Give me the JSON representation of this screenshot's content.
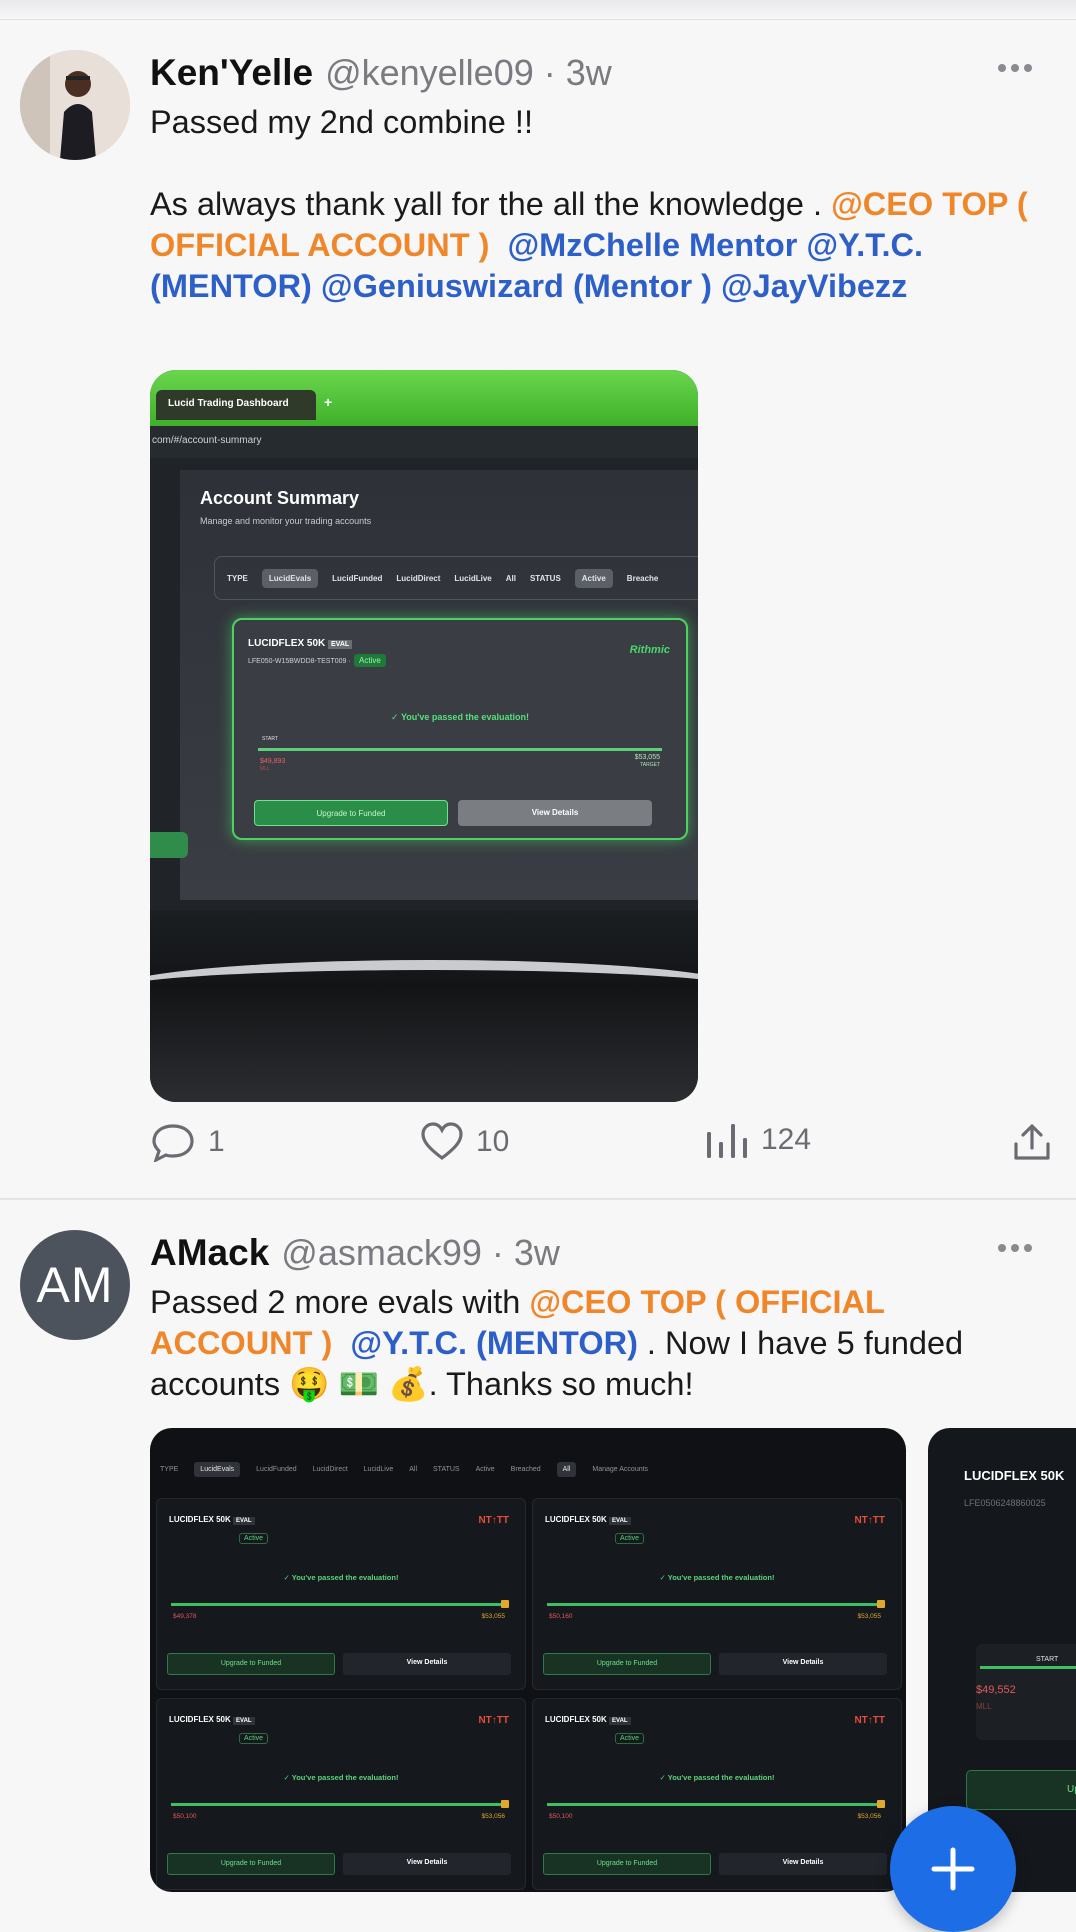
{
  "posts": [
    {
      "name": "Ken'Yelle",
      "handle": "@kenyelle09 · 3w",
      "line1": "Passed my 2nd combine !!",
      "line2_prefix": "As always thank yall for the all the knowledge . ",
      "mention_ceo": "@CEO TOP ( OFFICIAL ACCOUNT )",
      "mention_mzchelle": "@MzChelle Mentor",
      "mention_ytc": "@Y.T.C.  (MENTOR)",
      "mention_genius": "@Geniuswizard (Mentor )",
      "mention_jay": "@JayVibezz",
      "media": {
        "tab_title": "Lucid Trading Dashboard",
        "url": "com/#/account-summary",
        "heading": "Account Summary",
        "subheading": "Manage and monitor your trading accounts",
        "filter_type": "TYPE",
        "filters": [
          "LucidEvals",
          "LucidFunded",
          "LucidDirect",
          "LucidLive",
          "All"
        ],
        "status_label": "STATUS",
        "status_filters": [
          "Active",
          "Breache"
        ],
        "card_title": "LUCIDFLEX 50K",
        "card_tag": "EVAL",
        "card_id": "LFE050-W15BWDD8-TEST009 ·",
        "card_status": "Active",
        "provider": "Rithmic",
        "passed_text": "You've passed the evaluation!",
        "mll_value": "$49,893",
        "mll_label": "MLL",
        "target_value": "$53,055",
        "target_label": "TARGET",
        "start_label": "START",
        "upgrade_button": "Upgrade to Funded",
        "details_button": "View Details"
      },
      "actions": {
        "replies": "1",
        "likes": "10",
        "views": "124"
      }
    },
    {
      "name": "AMack",
      "handle": "@asmack99 · 3w",
      "avatar_initials": "AM",
      "text_prefix": "Passed 2 more evals with ",
      "mention_ceo": "@CEO TOP ( OFFICIAL ACCOUNT )",
      "mention_ytc": "@Y.T.C.  (MENTOR)",
      "text_mid": " .  Now I have 5 funded accounts 🤑 💵 💰.  Thanks so much!",
      "media": {
        "filter_type": "TYPE",
        "filters": [
          "LucidEvals",
          "LucidFunded",
          "LucidDirect",
          "LucidLive",
          "All"
        ],
        "status_label": "STATUS",
        "status_filters": [
          "Active",
          "Breached",
          "All"
        ],
        "manage": "Manage Accounts",
        "card_title": "LUCIDFLEX 50K",
        "card_tag": "EVAL",
        "card_status": "Active",
        "logo": "NT↑TT",
        "passed_text": "You've passed the evaluation!",
        "upgrade_button": "Upgrade to Funded",
        "details_button": "View Details",
        "cards": [
          {
            "left": "$49,378",
            "right": "$53,055"
          },
          {
            "left": "$50,160",
            "right": "$53,055"
          },
          {
            "left": "$50,100",
            "right": "$53,056"
          },
          {
            "left": "$50,100",
            "right": "$53,056"
          }
        ],
        "side_title": "LUCIDFLEX 50K",
        "side_id": "LFE0506248860025",
        "side_start": "START",
        "side_value": "$49,552",
        "side_label": "MLL",
        "side_button": "Up"
      }
    }
  ],
  "colors": {
    "mention_orange": "#f0862a",
    "mention_blue": "#2d5fc8",
    "fab": "#1d6ee6"
  },
  "icons": [
    "more-icon",
    "reply-icon",
    "like-icon",
    "views-icon",
    "share-icon",
    "plus-icon"
  ]
}
